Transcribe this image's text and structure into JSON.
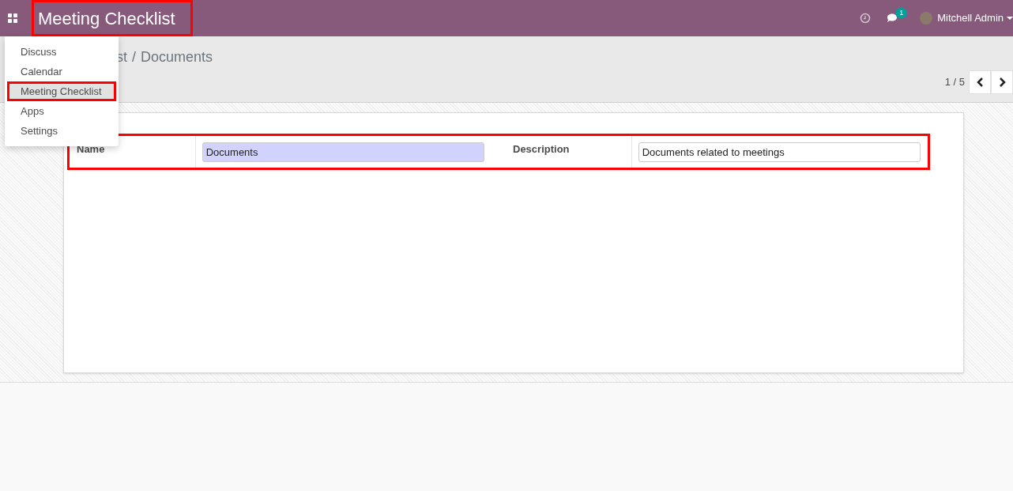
{
  "navbar": {
    "app_title": "Meeting Checklist",
    "app_title_highlighted": true,
    "chat_badge": "1",
    "user": "Mitchell Admin"
  },
  "app_menu": {
    "items": [
      {
        "label": "Discuss",
        "selected": false,
        "highlighted": false
      },
      {
        "label": "Calendar",
        "selected": false,
        "highlighted": false
      },
      {
        "label": "Meeting Checklist",
        "selected": true,
        "highlighted": true
      },
      {
        "label": "Apps",
        "selected": false,
        "highlighted": false
      },
      {
        "label": "Settings",
        "selected": false,
        "highlighted": false
      }
    ]
  },
  "breadcrumb": {
    "parent": "st",
    "separator": "/",
    "current": "Documents"
  },
  "pager": {
    "value": "1 / 5"
  },
  "form": {
    "highlighted": true,
    "fields": [
      {
        "label": "Name",
        "value": "Documents",
        "required": true
      },
      {
        "label": "Description",
        "value": "Documents related to meetings",
        "required": false
      }
    ]
  }
}
